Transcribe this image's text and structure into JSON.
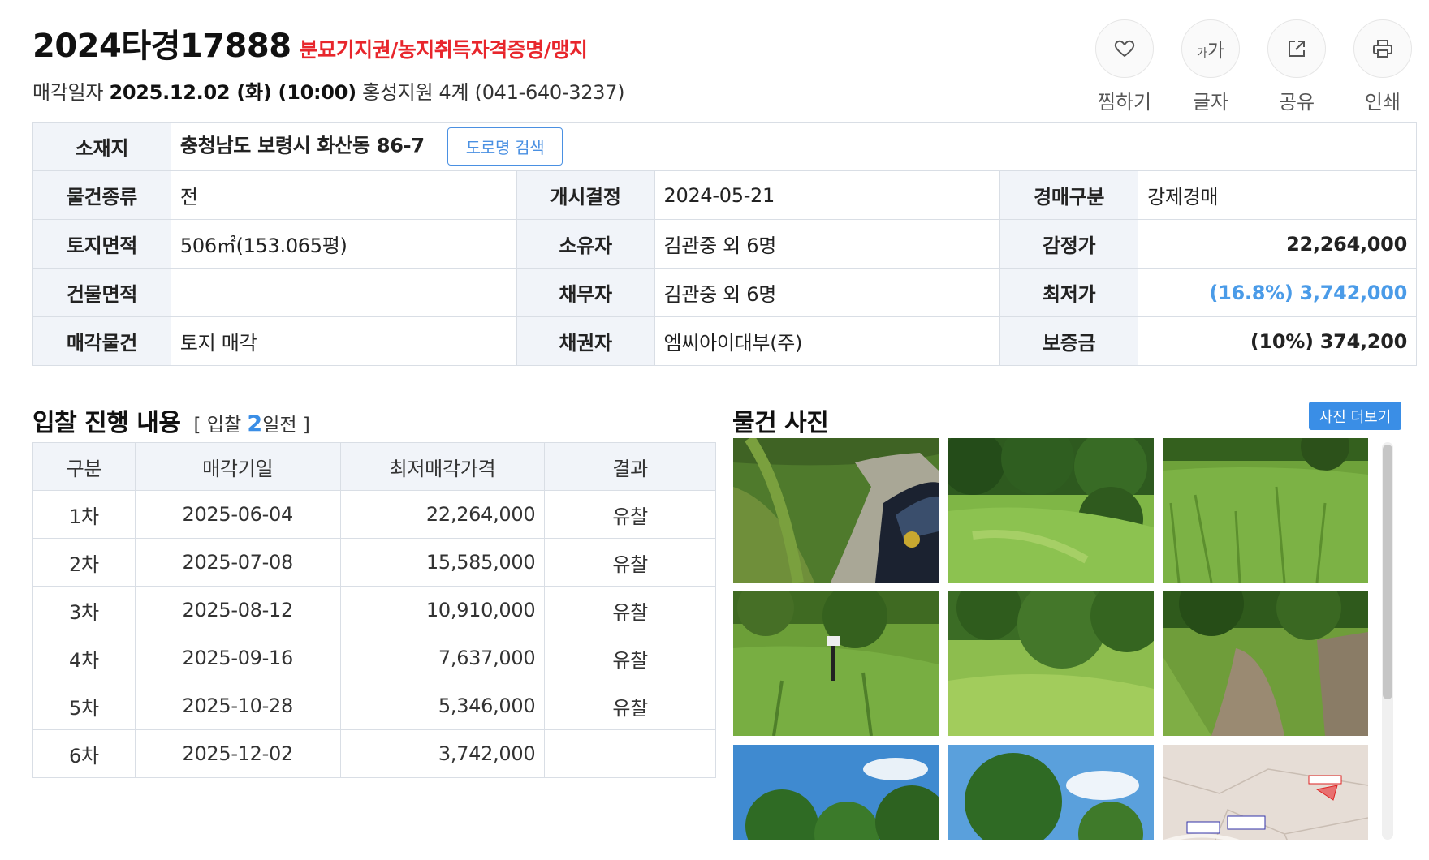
{
  "header": {
    "case_number": "2024타경17888",
    "case_tags": "분묘기지권/농지취득자격증명/맹지",
    "sale_label": "매각일자",
    "sale_datetime": "2025.12.02 (화) (10:00)",
    "court": "홍성지원 4계 (041-640-3237)"
  },
  "actions": [
    {
      "label": "찜하기",
      "icon": "heart-icon"
    },
    {
      "label": "글자",
      "icon": "font-size-icon"
    },
    {
      "label": "공유",
      "icon": "share-icon"
    },
    {
      "label": "인쇄",
      "icon": "print-icon"
    }
  ],
  "font_glyph": {
    "small": "가",
    "large": "가"
  },
  "info": {
    "address_label": "소재지",
    "address": "충청남도 보령시 화산동 86-7",
    "road_search": "도로명 검색",
    "rows": [
      [
        {
          "label": "물건종류",
          "value": "전"
        },
        {
          "label": "개시결정",
          "value": "2024-05-21"
        },
        {
          "label": "경매구분",
          "value": "강제경매"
        }
      ],
      [
        {
          "label": "토지면적",
          "value": "506㎡(153.065평)"
        },
        {
          "label": "소유자",
          "value": "김관중 외 6명"
        },
        {
          "label": "감정가",
          "value": "22,264,000"
        }
      ],
      [
        {
          "label": "건물면적",
          "value": ""
        },
        {
          "label": "채무자",
          "value": "김관중 외 6명"
        },
        {
          "label": "최저가",
          "value": "(16.8%) 3,742,000"
        }
      ],
      [
        {
          "label": "매각물건",
          "value": "토지 매각"
        },
        {
          "label": "채권자",
          "value": "엠씨아이대부(주)"
        },
        {
          "label": "보증금",
          "value": "(10%) 374,200"
        }
      ]
    ]
  },
  "colors": {
    "accent_blue": "#3a8ee6",
    "tag_red": "#e8262c",
    "label_bg": "#f1f4f9",
    "border": "#d9dee5"
  },
  "bid": {
    "title": "입찰 진행 내용",
    "sub_before": "[ 입찰 ",
    "sub_count": "2",
    "sub_after": "일전 ]",
    "headers": [
      "구분",
      "매각기일",
      "최저매각가격",
      "결과"
    ],
    "rows": [
      [
        "1차",
        "2025-06-04",
        "22,264,000",
        "유찰"
      ],
      [
        "2차",
        "2025-07-08",
        "15,585,000",
        "유찰"
      ],
      [
        "3차",
        "2025-08-12",
        "10,910,000",
        "유찰"
      ],
      [
        "4차",
        "2025-09-16",
        "7,637,000",
        "유찰"
      ],
      [
        "5차",
        "2025-10-28",
        "5,346,000",
        "유찰"
      ],
      [
        "6차",
        "2025-12-02",
        "3,742,000",
        ""
      ]
    ]
  },
  "photos": {
    "title": "물건 사진",
    "more_button": "사진 더보기",
    "items": [
      {
        "kind": "dirt-road-with-car"
      },
      {
        "kind": "forest-field"
      },
      {
        "kind": "grass-field"
      },
      {
        "kind": "grass-slope-with-sign"
      },
      {
        "kind": "trees-and-grass"
      },
      {
        "kind": "dirt-path"
      },
      {
        "kind": "trees-blue-sky"
      },
      {
        "kind": "tree-blue-sky"
      },
      {
        "kind": "cadastral-map"
      }
    ]
  }
}
